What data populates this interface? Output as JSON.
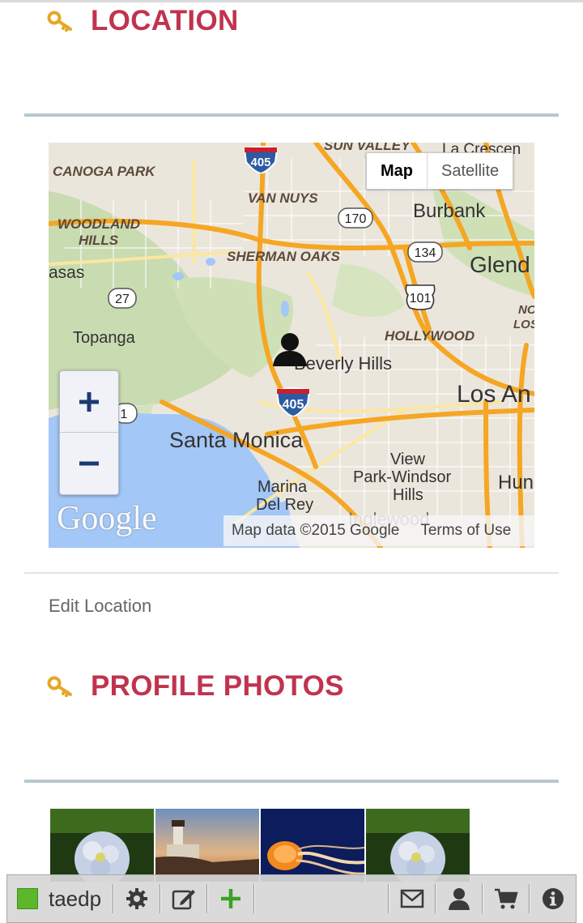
{
  "sections": {
    "location": {
      "title": "LOCATION",
      "icon": "key-icon"
    },
    "profile_photos": {
      "title": "PROFILE PHOTOS",
      "icon": "key-icon"
    }
  },
  "map": {
    "type_buttons": [
      "Map",
      "Satellite"
    ],
    "active_type": "Map",
    "zoom_in": "+",
    "zoom_out": "−",
    "logo": "Google",
    "attribution": "Map data ©2015 Google",
    "terms": "Terms of Use",
    "labels": {
      "canoga_park": "CANOGA PARK",
      "sun_valley": "SUN VALLEY",
      "la_crescenta": "La Crescen",
      "van_nuys": "VAN NUYS",
      "burbank": "Burbank",
      "woodland_hills_1": "WOODLAND",
      "woodland_hills_2": "HILLS",
      "sherman_oaks": "SHERMAN OAKS",
      "glendale": "Glend",
      "calabasas": "asas",
      "hollywood": "HOLLYWOOD",
      "topanga": "Topanga",
      "beverly_hills": "Beverly Hills",
      "los_angeles": "Los An",
      "nlos_1": "NO",
      "nlos_2": "LOS",
      "santa_monica": "Santa Monica",
      "view_park_1": "View",
      "view_park_2": "Park-Windsor",
      "view_park_3": "Hills",
      "marina_1": "Marina",
      "marina_2": "Del Rey",
      "inglewood": "Inglewood",
      "hun": "Hun"
    },
    "shields": {
      "i405_top": "405",
      "i405_mid": "405",
      "r170": "170",
      "r134": "134",
      "us101": "101",
      "r27": "27",
      "r1": "1"
    },
    "marker": "person-marker-icon"
  },
  "edit_location": "Edit Location",
  "photos": [
    {
      "name": "hydrangea-photo"
    },
    {
      "name": "lighthouse-photo"
    },
    {
      "name": "jellyfish-photo"
    },
    {
      "name": "hydrangea-photo"
    }
  ],
  "toolbar": {
    "username": "taedp",
    "status_color": "#5cb82a",
    "left_icons": [
      "gear-icon",
      "edit-icon",
      "plus-icon"
    ],
    "right_icons": [
      "mail-icon",
      "user-icon",
      "cart-icon",
      "info-icon"
    ]
  },
  "colors": {
    "title": "#c0334f",
    "key_icon": "#e5a824",
    "plus_icon": "#3aa024"
  }
}
